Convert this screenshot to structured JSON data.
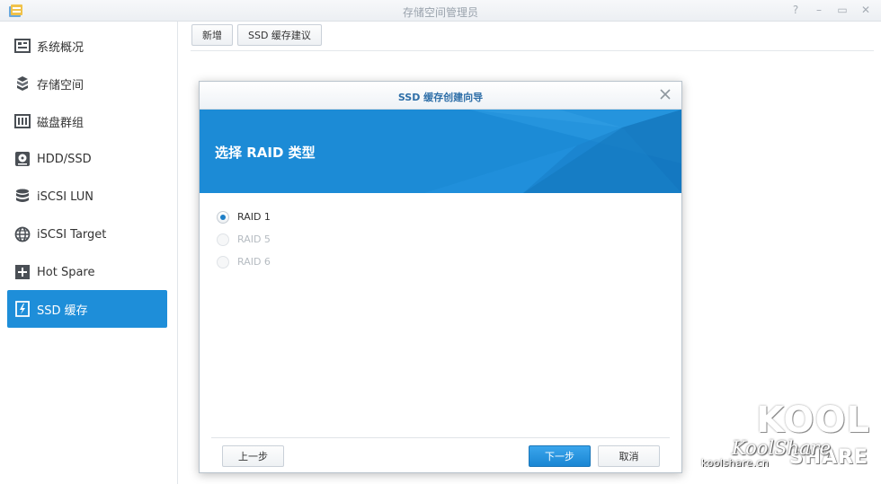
{
  "window": {
    "title": "存储空间管理员",
    "controls": [
      "?",
      "–",
      "▭",
      "✕"
    ]
  },
  "sidebar": {
    "items": [
      {
        "label": "系统概况",
        "icon": "overview-icon"
      },
      {
        "label": "存储空间",
        "icon": "storage-icon"
      },
      {
        "label": "磁盘群组",
        "icon": "disk-group-icon"
      },
      {
        "label": "HDD/SSD",
        "icon": "hdd-icon"
      },
      {
        "label": "iSCSI LUN",
        "icon": "database-icon"
      },
      {
        "label": "iSCSI Target",
        "icon": "globe-icon"
      },
      {
        "label": "Hot Spare",
        "icon": "plus-icon"
      },
      {
        "label": "SSD 缓存",
        "icon": "ssd-cache-icon",
        "active": true
      }
    ]
  },
  "toolbar": {
    "create_label": "新增",
    "advisor_label": "SSD 缓存建议"
  },
  "dialog": {
    "title": "SSD 缓存创建向导",
    "banner_title": "选择 RAID 类型",
    "options": [
      {
        "label": "RAID 1",
        "checked": true,
        "disabled": false
      },
      {
        "label": "RAID 5",
        "checked": false,
        "disabled": true
      },
      {
        "label": "RAID 6",
        "checked": false,
        "disabled": true
      }
    ],
    "prev_label": "上一步",
    "next_label": "下一步",
    "cancel_label": "取消"
  },
  "watermark": {
    "logo_top": "KOOL",
    "logo_bottom": "SHARE",
    "brand": "KoolShare",
    "url": "koolshare.cn"
  },
  "colors": {
    "accent": "#1e8ed9",
    "banner": "#1c8bd6",
    "dialog_title": "#2f6fa8"
  }
}
